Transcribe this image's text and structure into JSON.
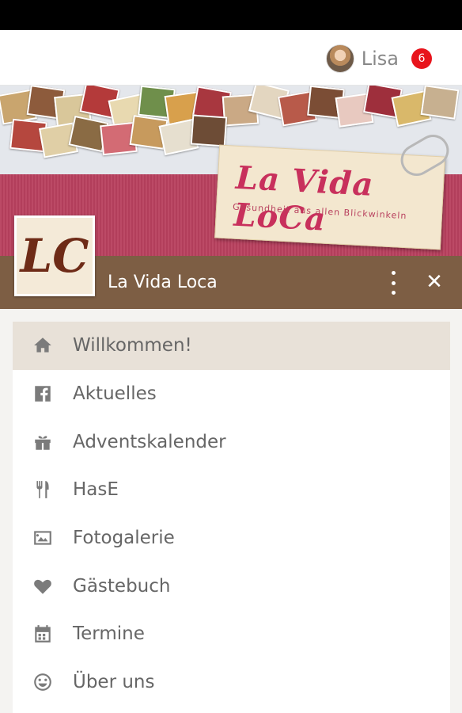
{
  "user": {
    "name": "Lisa",
    "notification_count": "6"
  },
  "banner": {
    "title": "La Vida LoCa",
    "subtitle": "Gesundheit aus allen Blickwinkeln"
  },
  "brand": {
    "logo_text": "LC",
    "name": "La Vida Loca"
  },
  "nav": {
    "items": [
      {
        "label": "Willkommen!",
        "icon": "home-icon",
        "active": true
      },
      {
        "label": "Aktuelles",
        "icon": "facebook-icon",
        "active": false
      },
      {
        "label": "Adventskalender",
        "icon": "gift-icon",
        "active": false
      },
      {
        "label": "HasE",
        "icon": "cutlery-icon",
        "active": false
      },
      {
        "label": "Fotogalerie",
        "icon": "image-icon",
        "active": false
      },
      {
        "label": "Gästebuch",
        "icon": "heart-icon",
        "active": false
      },
      {
        "label": "Termine",
        "icon": "calendar-icon",
        "active": false
      },
      {
        "label": "Über uns",
        "icon": "smiley-icon",
        "active": false
      }
    ]
  },
  "colors": {
    "status_bar": "#000000",
    "brand_bar": "#7d5e44",
    "active_item_bg": "#e8e1d8",
    "badge": "#e8141c",
    "banner_accent": "#b8405e"
  }
}
